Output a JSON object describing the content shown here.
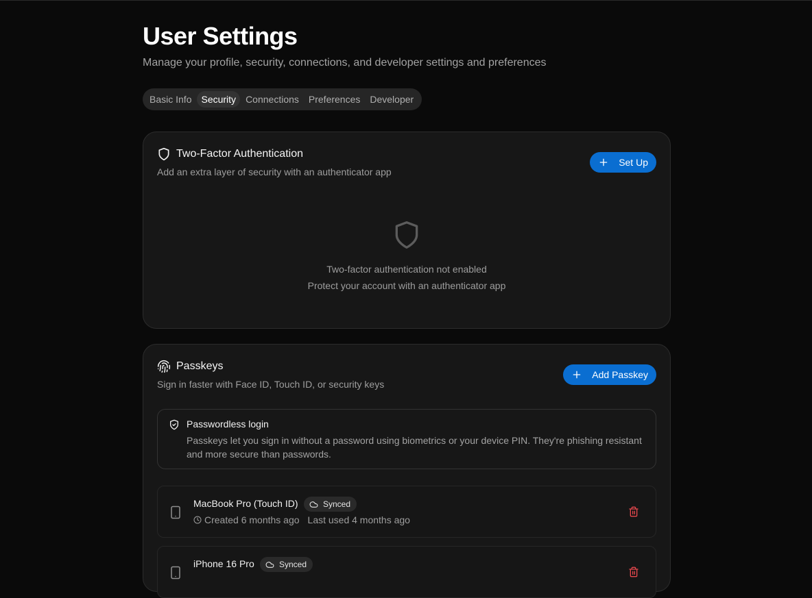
{
  "header": {
    "title": "User Settings",
    "subtitle": "Manage your profile, security, connections, and developer settings and preferences"
  },
  "tabs": [
    {
      "label": "Basic Info",
      "active": false
    },
    {
      "label": "Security",
      "active": true
    },
    {
      "label": "Connections",
      "active": false
    },
    {
      "label": "Preferences",
      "active": false
    },
    {
      "label": "Developer",
      "active": false
    }
  ],
  "two_factor": {
    "icon": "shield-icon",
    "title": "Two-Factor Authentication",
    "description": "Add an extra layer of security with an authenticator app",
    "button_label": "Set Up",
    "empty_icon": "shield-icon",
    "empty_title": "Two-factor authentication not enabled",
    "empty_subtitle": "Protect your account with an authenticator app"
  },
  "passkeys": {
    "icon": "fingerprint-icon",
    "title": "Passkeys",
    "description": "Sign in faster with Face ID, Touch ID, or security keys",
    "button_label": "Add Passkey",
    "info": {
      "icon": "shield-check-icon",
      "title": "Passwordless login",
      "text": "Passkeys let you sign in without a password using biometrics or your device PIN. They're phishing resistant and more secure than passwords."
    },
    "items": [
      {
        "name": "MacBook Pro (Touch ID)",
        "badge": "Synced",
        "created": "Created 6 months ago",
        "last_used": "Last used 4 months ago"
      },
      {
        "name": "iPhone 16 Pro",
        "badge": "Synced",
        "created": "",
        "last_used": ""
      }
    ]
  },
  "colors": {
    "background": "#0a0a0a",
    "card": "#171717",
    "accent": "#0a6ed1",
    "danger": "#e5484d"
  }
}
